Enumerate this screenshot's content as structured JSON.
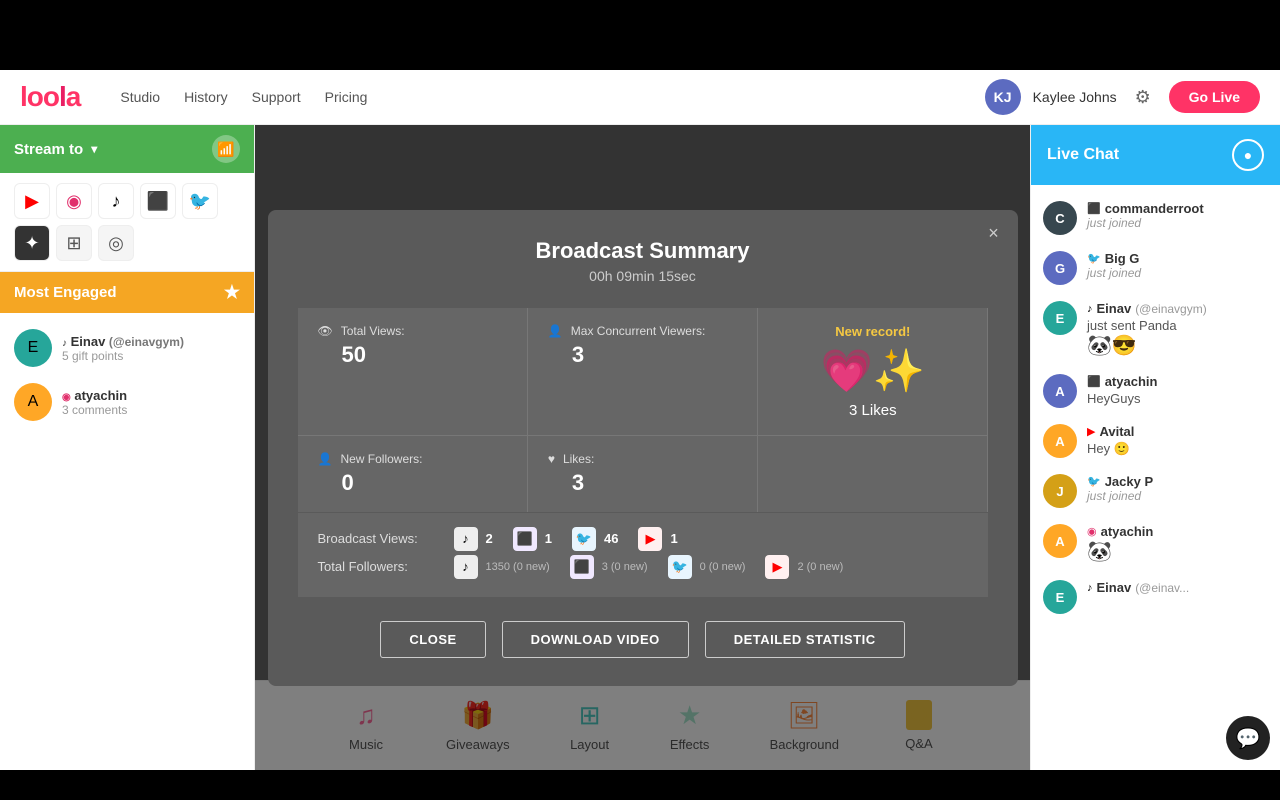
{
  "topBar": {
    "height": 70
  },
  "navbar": {
    "logo": "loola",
    "links": [
      "Studio",
      "History",
      "Support",
      "Pricing"
    ],
    "user": {
      "name": "Kaylee Johns",
      "initials": "KJ"
    },
    "goLiveLabel": "Go Live"
  },
  "sidebar": {
    "streamTo": {
      "label": "Stream to",
      "platforms": [
        {
          "id": "youtube",
          "symbol": "▶",
          "label": "YouTube"
        },
        {
          "id": "instagram",
          "symbol": "◉",
          "label": "Instagram"
        },
        {
          "id": "tiktok",
          "symbol": "♪",
          "label": "TikTok"
        },
        {
          "id": "twitch",
          "symbol": "⬛",
          "label": "Twitch"
        },
        {
          "id": "twitter",
          "symbol": "🐦",
          "label": "Twitter"
        },
        {
          "id": "dark1",
          "symbol": "✦",
          "label": "Other1"
        },
        {
          "id": "gray1",
          "symbol": "⊞",
          "label": "Other2"
        },
        {
          "id": "gray2",
          "symbol": "◎",
          "label": "Other3"
        }
      ]
    },
    "mostEngaged": {
      "label": "Most Engaged",
      "users": [
        {
          "name": "Einav",
          "handle": "@einavgym",
          "meta": "5 gift points",
          "platform": "tiktok",
          "initials": "E",
          "color": "av-teal"
        },
        {
          "name": "atyachin",
          "handle": "",
          "meta": "3 comments",
          "platform": "instagram",
          "initials": "A",
          "color": "av-orange"
        }
      ]
    }
  },
  "modal": {
    "title": "Broadcast Summary",
    "duration": "00h 09min 15sec",
    "closeLabel": "×",
    "stats": {
      "totalViews": {
        "label": "Total Views:",
        "value": "50"
      },
      "maxConcurrent": {
        "label": "Max Concurrent Viewers:",
        "value": "3"
      },
      "newRecord": "New record!",
      "newFollowers": {
        "label": "New Followers:",
        "value": "0"
      },
      "likes": {
        "label": "Likes:",
        "value": "3"
      },
      "likesRecord": "3 Likes"
    },
    "broadcastViews": "Broadcast Views:",
    "totalFollowers": "Total Followers:",
    "platforms": [
      {
        "id": "tiktok",
        "symbol": "♪",
        "color": "#000",
        "bg": "#eee",
        "views": "2",
        "followers": "1350 (0 new)"
      },
      {
        "id": "twitch",
        "symbol": "⬛",
        "color": "#9146ff",
        "bg": "#f0e8ff",
        "views": "1",
        "followers": "3 (0 new)"
      },
      {
        "id": "twitter",
        "symbol": "🐦",
        "color": "#1da1f2",
        "bg": "#e8f5fe",
        "views": "46",
        "followers": "0 (0 new)"
      },
      {
        "id": "youtube",
        "symbol": "▶",
        "color": "#ff0000",
        "bg": "#fff0f0",
        "views": "1",
        "followers": "2 (0 new)"
      }
    ],
    "buttons": {
      "close": "CLOSE",
      "download": "DOWNLOAD VIDEO",
      "detailed": "DETAILED STATISTIC"
    }
  },
  "toolbar": {
    "items": [
      {
        "id": "music",
        "label": "Music",
        "icon": "♫",
        "colorClass": "music"
      },
      {
        "id": "giveaways",
        "label": "Giveaways",
        "icon": "🎁",
        "colorClass": "giveaways"
      },
      {
        "id": "layout",
        "label": "Layout",
        "icon": "⊞",
        "colorClass": "layout"
      },
      {
        "id": "effects",
        "label": "Effects",
        "icon": "★",
        "colorClass": "effects"
      },
      {
        "id": "background",
        "label": "Background",
        "icon": "🖼",
        "colorClass": "background"
      },
      {
        "id": "qa",
        "label": "Q&A",
        "icon": "⬛",
        "colorClass": "qa"
      }
    ]
  },
  "liveChat": {
    "title": "Live Chat",
    "messages": [
      {
        "id": 1,
        "name": "commanderroot",
        "handle": "",
        "platform": "twitch",
        "platformSymbol": "⬛",
        "platformColor": "#9146ff",
        "text": "",
        "action": "just joined",
        "initials": "C",
        "color": "av-dark"
      },
      {
        "id": 2,
        "name": "Big G",
        "handle": "",
        "platform": "twitter",
        "platformSymbol": "🐦",
        "platformColor": "#1da1f2",
        "text": "",
        "action": "just joined",
        "initials": "G",
        "color": "av-blue"
      },
      {
        "id": 3,
        "name": "Einav",
        "handle": "(@einavgym)",
        "platform": "tiktok",
        "platformSymbol": "♪",
        "platformColor": "#000",
        "text": "just sent Panda",
        "emoji": "🐼😎",
        "initials": "E",
        "color": "av-teal"
      },
      {
        "id": 4,
        "name": "atyachin",
        "handle": "",
        "platform": "twitch",
        "platformSymbol": "⬛",
        "platformColor": "#9146ff",
        "text": "HeyGuys",
        "initials": "A",
        "color": "av-blue"
      },
      {
        "id": 5,
        "name": "Avital",
        "handle": "",
        "platform": "youtube",
        "platformSymbol": "▶",
        "platformColor": "#ff0000",
        "text": "Hey 🙂",
        "initials": "A",
        "color": "av-orange"
      },
      {
        "id": 6,
        "name": "Jacky P",
        "handle": "",
        "platform": "twitter",
        "platformSymbol": "🐦",
        "platformColor": "#1da1f2",
        "text": "",
        "action": "just joined",
        "initials": "J",
        "color": "av-yellow"
      },
      {
        "id": 7,
        "name": "atyachin",
        "handle": "",
        "platform": "instagram",
        "platformSymbol": "◉",
        "platformColor": "#e1306c",
        "text": "🐼",
        "initials": "A",
        "color": "av-orange"
      },
      {
        "id": 8,
        "name": "Einav",
        "handle": "(@einav...",
        "platform": "tiktok",
        "platformSymbol": "♪",
        "platformColor": "#000",
        "text": "",
        "initials": "E",
        "color": "av-teal"
      }
    ]
  }
}
